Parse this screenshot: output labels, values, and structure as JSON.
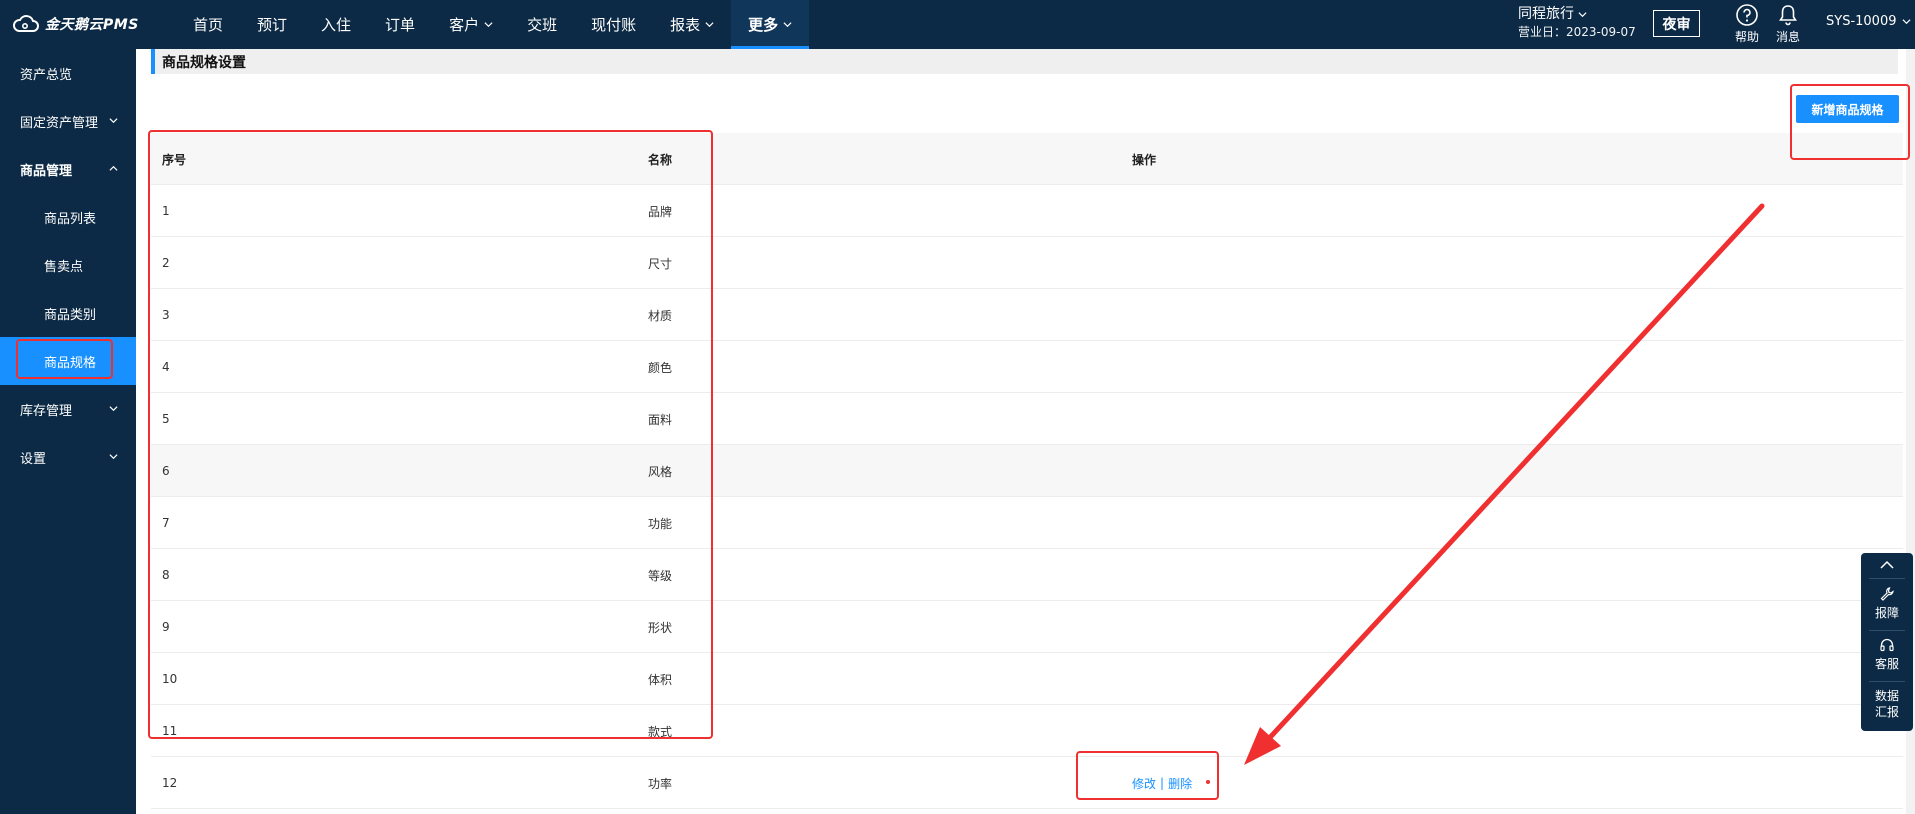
{
  "app": {
    "logo_text": "金天鹅云PMS"
  },
  "nav": {
    "items": [
      {
        "label": "首页",
        "dropdown": false
      },
      {
        "label": "预订",
        "dropdown": false
      },
      {
        "label": "入住",
        "dropdown": false
      },
      {
        "label": "订单",
        "dropdown": false
      },
      {
        "label": "客户",
        "dropdown": true
      },
      {
        "label": "交班",
        "dropdown": false
      },
      {
        "label": "现付账",
        "dropdown": false
      },
      {
        "label": "报表",
        "dropdown": true
      },
      {
        "label": "更多",
        "dropdown": true,
        "active": true
      }
    ]
  },
  "header_right": {
    "hotel_name": "同程旅行",
    "business_date": "营业日：2023-09-07",
    "night_audit_label": "夜审",
    "help_label": "帮助",
    "messages_label": "消息",
    "user": "SYS-10009"
  },
  "sidebar": {
    "items": [
      {
        "label": "资产总览",
        "level": 1
      },
      {
        "label": "固定资产管理",
        "level": 1,
        "chevron": "down"
      },
      {
        "label": "商品管理",
        "level": 1,
        "chevron": "up",
        "bold": true
      },
      {
        "label": "商品列表",
        "level": 2
      },
      {
        "label": "售卖点",
        "level": 2
      },
      {
        "label": "商品类别",
        "level": 2
      },
      {
        "label": "商品规格",
        "level": 2,
        "active": true
      },
      {
        "label": "库存管理",
        "level": 1,
        "chevron": "down"
      },
      {
        "label": "设置",
        "level": 1,
        "chevron": "down"
      }
    ]
  },
  "page": {
    "title": "商品规格设置",
    "add_button_label": "新增商品规格"
  },
  "table": {
    "columns": [
      "序号",
      "名称",
      "操作"
    ],
    "rows": [
      {
        "idx": "1",
        "name": "品牌"
      },
      {
        "idx": "2",
        "name": "尺寸"
      },
      {
        "idx": "3",
        "name": "材质"
      },
      {
        "idx": "4",
        "name": "颜色"
      },
      {
        "idx": "5",
        "name": "面料"
      },
      {
        "idx": "6",
        "name": "风格"
      },
      {
        "idx": "7",
        "name": "功能"
      },
      {
        "idx": "8",
        "name": "等级"
      },
      {
        "idx": "9",
        "name": "形状"
      },
      {
        "idx": "10",
        "name": "体积"
      },
      {
        "idx": "11",
        "name": "款式"
      },
      {
        "idx": "12",
        "name": "功率",
        "actions": {
          "edit": "修改",
          "separator": "|",
          "delete": "删除"
        }
      }
    ]
  },
  "float_widget": {
    "report_issue": "报障",
    "customer_service": "客服",
    "data_report": "数据汇报"
  },
  "colors": {
    "navy": "#0c2a45",
    "accent": "#1890ff",
    "annotation": "#f03030"
  }
}
